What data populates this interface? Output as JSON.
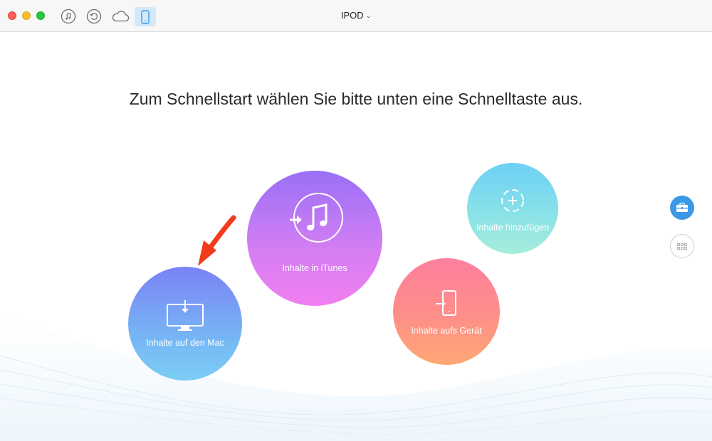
{
  "window": {
    "device_title": "IPOD",
    "toolbar_icons": [
      "music-note-icon",
      "restore-icon",
      "cloud-icon",
      "phone-icon"
    ],
    "active_toolbar_icon": "phone-icon"
  },
  "main": {
    "headline": "Zum Schnellstart wählen Sie bitte unten eine Schnelltaste aus.",
    "actions": [
      {
        "label": "Inhalte auf den Mac",
        "icon": "monitor-download-icon"
      },
      {
        "label": "Inhalte in iTunes",
        "icon": "itunes-transfer-icon"
      },
      {
        "label": "Inhalte hinzufügen",
        "icon": "add-crosshair-icon"
      },
      {
        "label": "Inhalte aufs Gerät",
        "icon": "device-import-icon"
      }
    ]
  },
  "sidebar": {
    "buttons": [
      "toolbox-icon",
      "grid-icon"
    ]
  },
  "colors": {
    "accent": "#3b98e6",
    "mac_bubble": "#7b82f5",
    "itunes_bubble": "#b476f5",
    "add_bubble": "#7fdbe8",
    "device_bubble": "#fe8a90",
    "arrow": "#f23a1c"
  }
}
